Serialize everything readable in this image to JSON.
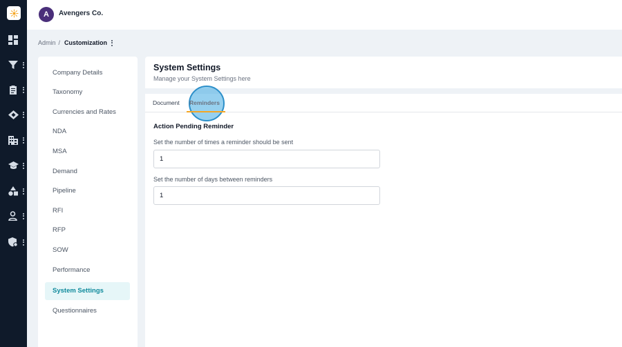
{
  "brand": {
    "name": "Avengers Co.",
    "logo_letter": "A"
  },
  "rail": {
    "items": [
      {
        "icon": "dashboard-icon"
      },
      {
        "icon": "filter-icon"
      },
      {
        "icon": "clipboard-icon"
      },
      {
        "icon": "handshake-icon"
      },
      {
        "icon": "building-icon"
      },
      {
        "icon": "graduation-cap-icon"
      },
      {
        "icon": "shapes-icon"
      },
      {
        "icon": "user-icon"
      },
      {
        "icon": "settings-shield-icon"
      }
    ]
  },
  "breadcrumb": {
    "parent": "Admin",
    "separator": "/",
    "current": "Customization"
  },
  "menu": {
    "items": [
      {
        "label": "Company Details"
      },
      {
        "label": "Taxonomy"
      },
      {
        "label": "Currencies and Rates"
      },
      {
        "label": "NDA"
      },
      {
        "label": "MSA"
      },
      {
        "label": "Demand"
      },
      {
        "label": "Pipeline"
      },
      {
        "label": "RFI"
      },
      {
        "label": "RFP"
      },
      {
        "label": "SOW"
      },
      {
        "label": "Performance"
      },
      {
        "label": "System Settings"
      },
      {
        "label": "Questionnaires"
      }
    ],
    "active_index": 11
  },
  "header": {
    "title": "System Settings",
    "subtitle": "Manage your System Settings here"
  },
  "tabs": [
    {
      "label": "Document"
    },
    {
      "label": "Reminders"
    }
  ],
  "section": {
    "title": "Action Pending Reminder",
    "fields": [
      {
        "label": "Set the number of times a reminder should be sent",
        "value": "1"
      },
      {
        "label": "Set the number of days between reminders",
        "value": "1"
      }
    ]
  },
  "colors": {
    "rail": "#0f1a2a",
    "accent": "#0f8a9c",
    "tab_underline": "#f5a623",
    "click_ring": "#40aae1"
  }
}
